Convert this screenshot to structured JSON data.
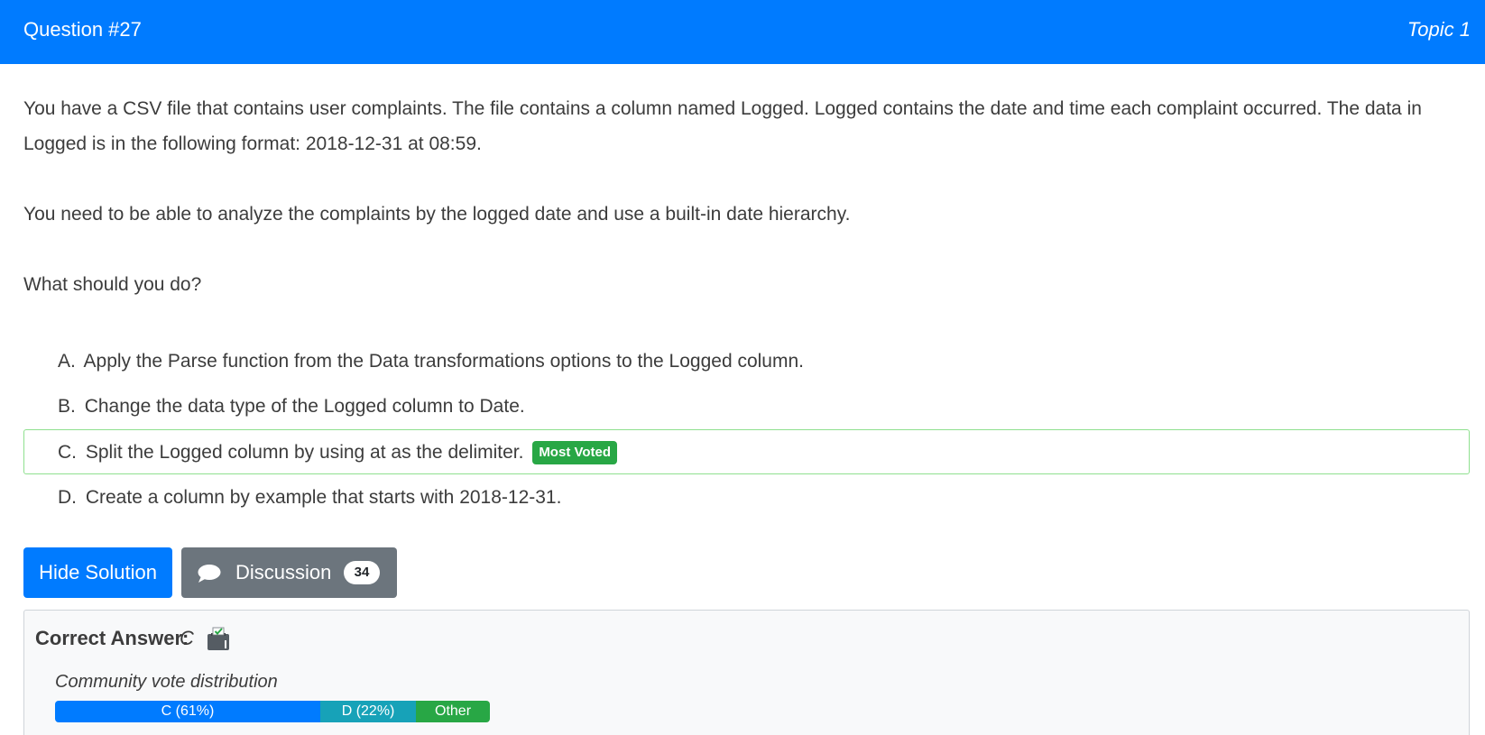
{
  "header": {
    "title": "Question #27",
    "topic": "Topic 1"
  },
  "question": {
    "paragraphs": [
      "You have a CSV file that contains user complaints. The file contains a column named Logged. Logged contains the date and time each complaint occurred. The data in Logged is in the following format: 2018-12-31 at 08:59.",
      "You need to be able to analyze the complaints by the logged date and use a built-in date hierarchy.",
      "What should you do?"
    ]
  },
  "choices": [
    {
      "letter": "A.",
      "text": "Apply the Parse function from the Data transformations options to the Logged column."
    },
    {
      "letter": "B.",
      "text": "Change the data type of the Logged column to Date."
    },
    {
      "letter": "C.",
      "text": "Split the Logged column by using at as the delimiter.",
      "badge": "Most Voted"
    },
    {
      "letter": "D.",
      "text": "Create a column by example that starts with 2018-12-31."
    }
  ],
  "buttons": {
    "hide_solution": "Hide Solution",
    "discussion": "Discussion",
    "discussion_count": "34"
  },
  "answer": {
    "label": "Correct Answer:",
    "value": "C",
    "vote_caption": "Community vote distribution",
    "votes": [
      {
        "label": "C (61%)",
        "percent": 61,
        "color": "#007bff"
      },
      {
        "label": "D (22%)",
        "percent": 22,
        "color": "#17a2b8"
      },
      {
        "label": "Other",
        "percent": 17,
        "color": "#28a745"
      }
    ]
  },
  "colors": {
    "primary": "#007bff",
    "secondary": "#6c757d",
    "success": "#28a745",
    "info": "#17a2b8"
  },
  "icons": {
    "discussion": "comment-icon",
    "answer": "ballot-box-icon"
  }
}
